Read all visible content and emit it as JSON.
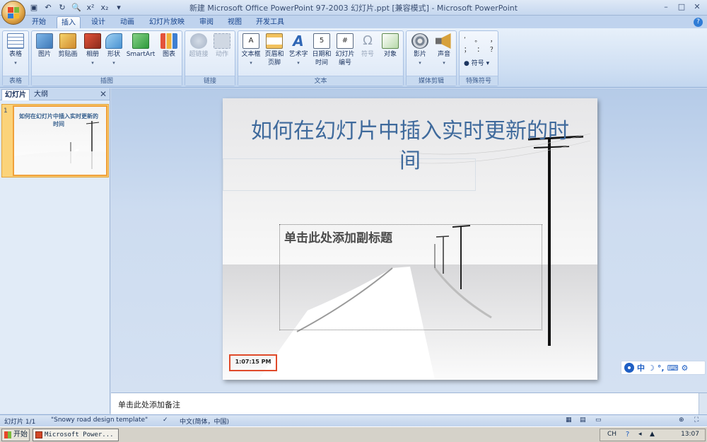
{
  "window": {
    "title": "新建 Microsoft Office PowerPoint 97-2003 幻灯片.ppt [兼容模式] - Microsoft PowerPoint"
  },
  "tabs": [
    "开始",
    "插入",
    "设计",
    "动画",
    "幻灯片放映",
    "审阅",
    "视图",
    "开发工具"
  ],
  "ribbon": {
    "groups": {
      "tables": "表格",
      "illustrations": "插图",
      "links": "链接",
      "text": "文本",
      "media": "媒体剪辑",
      "symbols": "特殊符号"
    },
    "buttons": {
      "table": "表格",
      "picture": "图片",
      "clipart": "剪贴画",
      "album": "相册",
      "shapes": "形状",
      "smartart": "SmartArt",
      "chart": "图表",
      "hyperlink": "超链接",
      "action": "动作",
      "textbox": "文本框",
      "header_footer_1": "页眉和",
      "header_footer_2": "页脚",
      "wordart": "艺术字",
      "datetime_1": "日期和",
      "datetime_2": "时间",
      "slide_number_1": "幻灯片",
      "slide_number_2": "编号",
      "symbol": "符号",
      "object": "对象",
      "movie": "影片",
      "sound": "声音",
      "special_symbol": "符号"
    }
  },
  "panel": {
    "tab_slides": "幻灯片",
    "tab_outline": "大纲",
    "slide_number": "1",
    "thumb_title": "如何在幻灯片中插入实时更新的时间"
  },
  "slide": {
    "title": "如何在幻灯片中插入实时更新的时间",
    "subtitle_placeholder": "单击此处添加副标题",
    "time": "1:07:15 PM"
  },
  "notes": {
    "placeholder": "单击此处添加备注"
  },
  "statusbar": {
    "slide_info": "幻灯片 1/1",
    "template": "\"Snowy road design template\"",
    "language": "中文(简体，中国)"
  },
  "taskbar": {
    "start": "开始",
    "task": "Microsoft Power...",
    "lang": "CH",
    "clock": "13:07"
  },
  "ime": {
    "mode": "中"
  },
  "colors": {
    "ribbon_bg": "#cfdff3",
    "title_text": "#3f6a9c",
    "highlight_red": "#e04a2a",
    "thumb_selected": "#f0a03a"
  }
}
